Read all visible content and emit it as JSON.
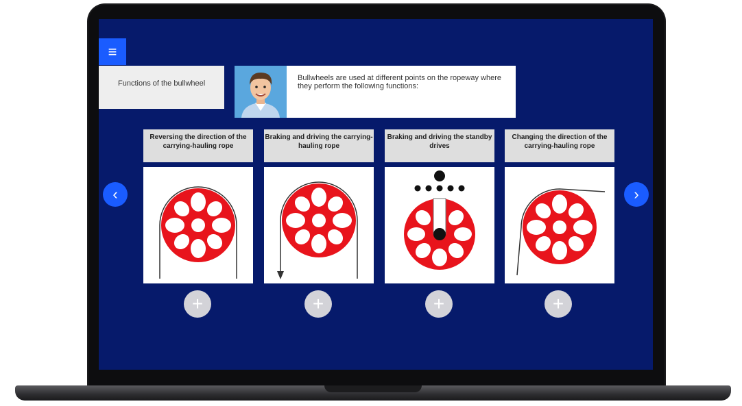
{
  "app": {
    "menu_icon": "hamburger-menu-icon",
    "topic_title": "Functions of the bullwheel",
    "intro_text": "Bullwheels are used at different points on the ropeway where they perform the following functions:"
  },
  "cards": [
    {
      "title": "Reversing the direction of the carrying-hauling rope"
    },
    {
      "title": "Braking and driving the carrying-hauling rope"
    },
    {
      "title": "Braking and driving the standby drives"
    },
    {
      "title": "Changing the direction of the carrying-hauling rope"
    }
  ],
  "colors": {
    "screen_bg": "#061a6b",
    "accent": "#1a5cff",
    "wheel": "#e8141c"
  }
}
